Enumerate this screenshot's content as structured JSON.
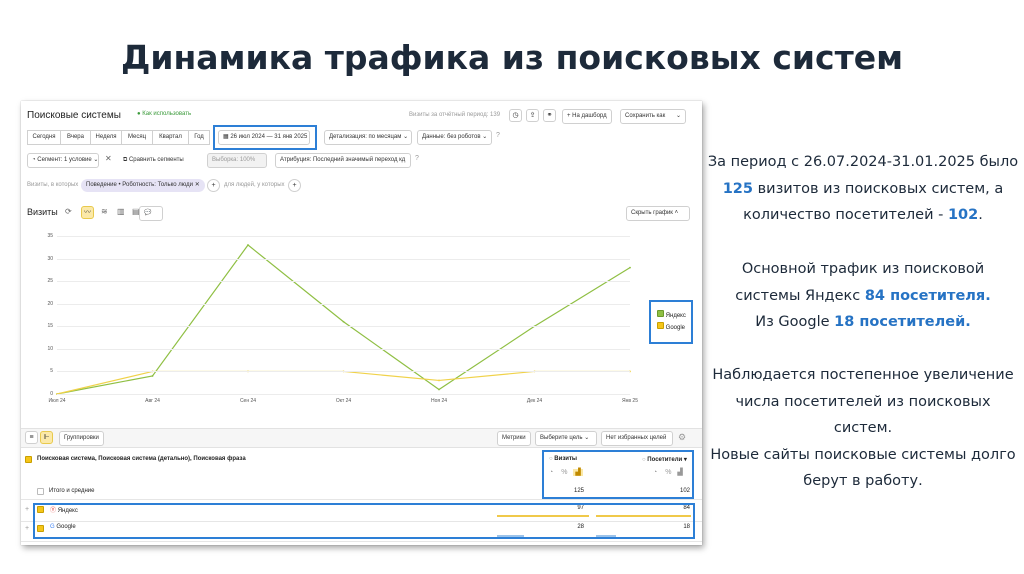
{
  "slide": {
    "title": "Динамика трафика из поисковых систем",
    "accent_color": "#2673c4",
    "highlight_color": "#2d7fd6",
    "yandex_color": "#8fbf43",
    "google_color": "#f0d24a",
    "paragraph1": {
      "a": "За период с 26.07.2024-31.01.2025 было",
      "b_num": "125",
      "b_rest": " визитов из поисковых систем, а",
      "c_pre": "количество посетителей - ",
      "c_num": "102",
      "c_post": "."
    },
    "paragraph2": {
      "a": "Основной трафик из поисковой",
      "b_pre": "системы Яндекс ",
      "b_num": "84 посетителя.",
      "c_pre": "Из Google ",
      "c_num": "18 посетителей."
    },
    "paragraph3": {
      "a": "Наблюдается постепенное увеличение",
      "b": "числа посетителей из поисковых",
      "c": "систем.",
      "d": "Новые сайты поисковые системы долго",
      "e": "берут в работу."
    }
  },
  "report": {
    "title": "Поисковые системы",
    "how_to_use": "Как использовать",
    "visits_period": "Визиты за отчётный период: 139",
    "to_dashboard": "+ На дашборд",
    "save_as": "Сохранить как",
    "periods": [
      "Сегодня",
      "Вчера",
      "Неделя",
      "Месяц",
      "Квартал",
      "Год"
    ],
    "date_range": "26 июл 2024 — 31 янв 2025",
    "detail": "Детализация: по месяцам",
    "data_mode": "Данные: без роботов",
    "segment": "Сегмент: 1 условие",
    "compare_segments": "Сравнить сегменты",
    "sample": "Выборка: 100%",
    "attribution": "Атрибуция: Последний значимый переход  кд",
    "visits_which": "Визиты, в которых",
    "condition": "Поведение • Роботность: Только люди",
    "for_people": "для людей, у которых",
    "metric_label": "Визиты",
    "hide_chart": "Скрыть график",
    "groupings": "Группировки",
    "metrics": "Метрики",
    "choose_goal": "Выберите цель",
    "no_goals": "Нет избранных целей",
    "dimension_header": "Поисковая система, Поисковая система (детально), Поисковая фраза",
    "col_visits": "Визиты",
    "col_visitors": "Посетители",
    "totals_label": "Итого и средние",
    "totals": {
      "visits": "125",
      "visitors": "102"
    },
    "rows": [
      {
        "label": "Яндекс",
        "visits": "97",
        "visitors": "84"
      },
      {
        "label": "Google",
        "visits": "28",
        "visitors": "18"
      }
    ]
  },
  "chart_data": {
    "type": "line",
    "categories": [
      "Июл 24",
      "Авг 24",
      "Сен 24",
      "Окт 24",
      "Ноя 24",
      "Дек 24",
      "Янв 25"
    ],
    "ylim": [
      0,
      35
    ],
    "yticks": [
      0,
      5,
      10,
      15,
      20,
      25,
      30,
      35
    ],
    "legend_position": "right",
    "grid": true,
    "series": [
      {
        "name": "Яндекс",
        "color": "#8fbf43",
        "values": [
          0,
          4,
          33,
          16,
          1,
          15,
          28
        ]
      },
      {
        "name": "Google",
        "color": "#f0d24a",
        "values": [
          0,
          5,
          5,
          5,
          3,
          5,
          5
        ]
      }
    ]
  }
}
